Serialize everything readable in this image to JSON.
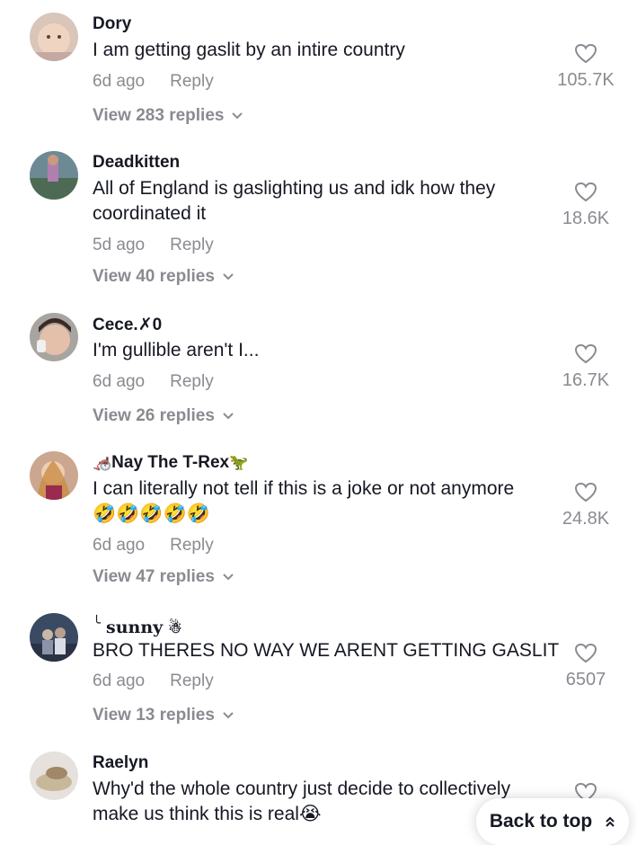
{
  "colors": {
    "text": "#161823",
    "muted": "#8a8b91",
    "background": "#ffffff"
  },
  "comments": [
    {
      "username": "Dory",
      "text": "I am getting gaslit by an intire country",
      "time": "6d ago",
      "reply": "Reply",
      "view_replies": "View 283 replies",
      "likes": "105.7K"
    },
    {
      "username": "Deadkitten",
      "text": "All of England is gaslighting us and idk how they coordinated it",
      "time": "5d ago",
      "reply": "Reply",
      "view_replies": "View 40 replies",
      "likes": "18.6K"
    },
    {
      "username": "Cece.✗0",
      "text": "I'm gullible aren't I...",
      "time": "6d ago",
      "reply": "Reply",
      "view_replies": "View 26 replies",
      "likes": "16.7K"
    },
    {
      "username": "Nay The T-Rex",
      "username_prefix": "🦽",
      "username_suffix": "🦖",
      "text": "I can literally not tell if this is a joke or not anymore",
      "text_emoji": "🤣🤣🤣🤣🤣",
      "time": "6d ago",
      "reply": "Reply",
      "view_replies": "View 47 replies",
      "likes": "24.8K"
    },
    {
      "username": "sunny",
      "username_prefix": "╰",
      "username_suffix": "☃",
      "text": "BRO THERES NO WAY WE ARENT GETTING GASLIT",
      "time": "6d ago",
      "reply": "Reply",
      "view_replies": "View 13 replies",
      "likes": "6507"
    },
    {
      "username": "Raelyn",
      "text": "Why'd the whole country just decide to collectively make us think this is real",
      "text_emoji": "😭"
    }
  ],
  "back_to_top": {
    "label": "Back to top"
  },
  "icons": {
    "like": "heart-outline-icon",
    "expand": "chevron-down-icon",
    "scroll_top": "double-chevron-up-icon"
  }
}
